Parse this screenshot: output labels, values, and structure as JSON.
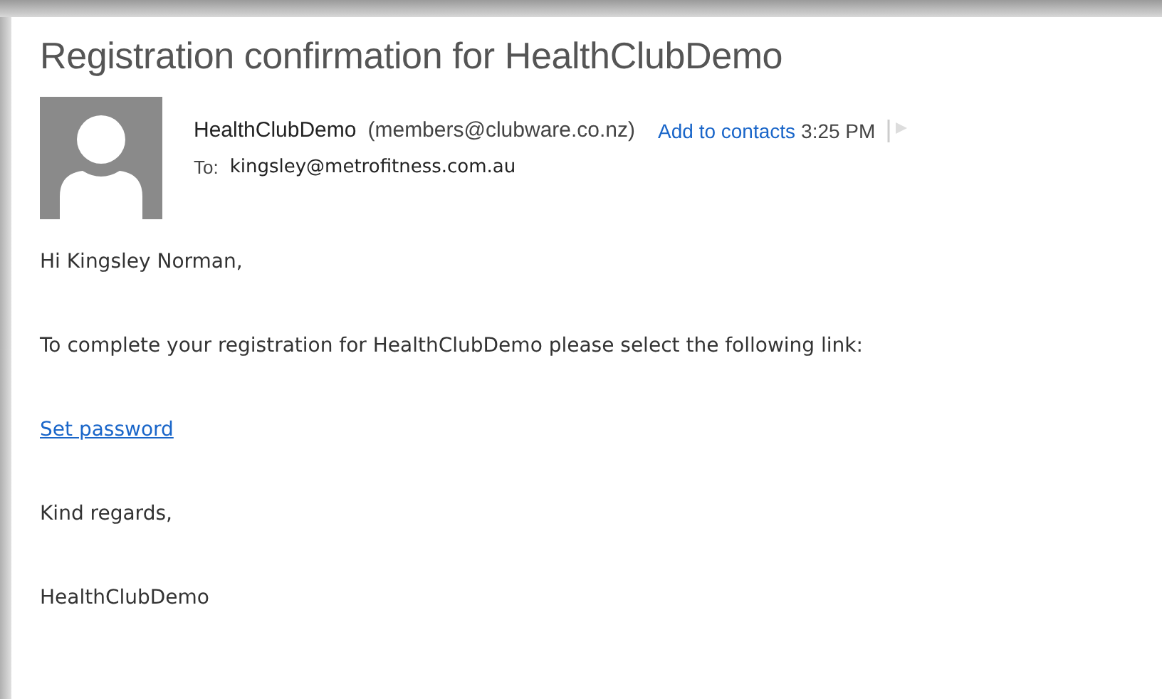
{
  "subject": "Registration confirmation for HealthClubDemo",
  "sender": {
    "name": "HealthClubDemo",
    "address": "(members@clubware.co.nz)",
    "add_contact": "Add to contacts",
    "time": "3:25 PM"
  },
  "to": {
    "label": "To:",
    "address": "kingsley@metrofitness.com.au"
  },
  "body": [
    {
      "kind": "text",
      "text": "Hi Kingsley Norman,"
    },
    {
      "kind": "text",
      "text": "To complete your registration for HealthClubDemo please select the following link:"
    },
    {
      "kind": "link",
      "text": "Set password"
    },
    {
      "kind": "text",
      "text": "Kind regards,"
    },
    {
      "kind": "text",
      "text": "HealthClubDemo"
    }
  ]
}
